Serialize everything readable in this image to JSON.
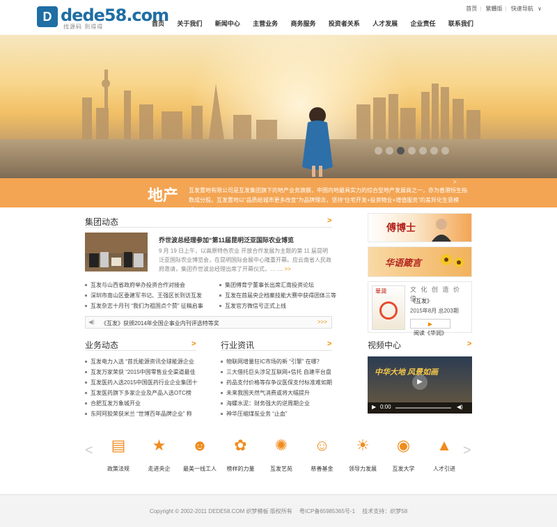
{
  "site": {
    "logo_text": "dede58.com",
    "logo_mark": "D",
    "logo_sub": "找源码  到得得"
  },
  "top_links": [
    "首页",
    "繁體版",
    "快速导航"
  ],
  "nav": [
    "首页",
    "关于我们",
    "新闻中心",
    "主营业务",
    "商务服务",
    "投资者关系",
    "人才发展",
    "企业责任",
    "联系我们"
  ],
  "banner": {
    "caption_title": "地产",
    "caption_text": "互发置地有限公司是互发集团旗下的地产业务旗舰，中国内地最具实力的综合型地产发展商之一，亦为香港恒生指数成分股。互发置地以“品质给城市更多改变”为品牌理念，坚持“住宅开发+投资物业+增值服务”的差异化生意模式。",
    "dot_count": 7,
    "active_dot": 2
  },
  "group_news": {
    "title": "集团动态",
    "more": ">",
    "feature_title": "乔世波总经理参加“第11届昆明泛亚国际农业博览",
    "feature_text": "9 月 19 日上午，以高原特色农业 开放合作发展为主题的第 11 届昆明泛亚国际农业博览会，在昆明国际会展中心隆重开幕。应云南省人民政府邀请，集团乔世波总经理出席了开幕仪式，… …",
    "feature_more": ">>",
    "list_left": [
      "互发与山西省政府举办投资合作对接会",
      "深圳市南山区委建军书记、王强区长到访互发",
      "互发杂志十月刊 “我们为祖国点个赞” 征稿启事"
    ],
    "list_right": [
      "集团傅育宁董事长出席汇南投资论坛",
      "互发在首届央企档案技能大赛中获得团体三等",
      "互发官方微信号正式上线"
    ]
  },
  "notice": {
    "icon": "◀)",
    "text": "《互发》获颁2014年全国企事业内刊评选特等奖",
    "more": ">>>"
  },
  "business_news": {
    "title": "业务动态",
    "more": ">",
    "items": [
      "互发电力入选 “首氏能源资讯全球能源企业",
      "互发万家荣获 “2015中国零售业全渠道最佳",
      "互发医药入选2015中国医药行业企业集团十",
      "互发医药旗下多家企业及产品入选OTC榜",
      "合肥互发万象城开业",
      "东阿阿胶荣获米兰 “世博百年品牌企业” 称"
    ]
  },
  "industry_news": {
    "title": "行业资讯",
    "more": ">",
    "items": [
      "物联网增量狂IC市场的新 “引擎” 在哪？",
      "三大借托巨头涉足互联网+信托 自建平台盘",
      "药品支付价格等存争议医保支付标准难如期",
      "未来我国天然气消费或将大幅提升",
      "海螺水泥：财务强大的逆周期企业",
      "神华压缩煤炭业务 “止血”"
    ]
  },
  "side": {
    "banner1_text": "傅博士",
    "banner2_text": "华语箴言",
    "magazine": {
      "slogan": "文 化 创 造 价 值",
      "name": "《互发》",
      "issue": "2015年8月 总203期",
      "button": "阅读《华润》",
      "cover_title": "華潤"
    },
    "video_title": "视频中心",
    "video_more": ">",
    "video_overlay": "中华大地  风景如画",
    "video_time": "0:00"
  },
  "icon_strip": [
    {
      "icon": "file-icon",
      "glyph": "▤",
      "label": "政策法规"
    },
    {
      "icon": "star-icon",
      "glyph": "★",
      "label": "走进央企"
    },
    {
      "icon": "worker-icon",
      "glyph": "☻",
      "label": "最美一线工人"
    },
    {
      "icon": "medal-icon",
      "glyph": "✿",
      "label": "榜样的力量"
    },
    {
      "icon": "art-icon",
      "glyph": "✺",
      "label": "互发艺苑"
    },
    {
      "icon": "charity-icon",
      "glyph": "☺",
      "label": "慈善基金"
    },
    {
      "icon": "sun-icon",
      "glyph": "☀",
      "label": "领导力发展"
    },
    {
      "icon": "university-icon",
      "glyph": "◉",
      "label": "互发大学"
    },
    {
      "icon": "graduation-icon",
      "glyph": "▲",
      "label": "人才引进"
    }
  ],
  "footer": {
    "copyright": "Copyright © 2002-2011 DEDE58.COM 织梦模板 版权所有",
    "icp": "粤ICP备65985365号-1",
    "support": "技术支持：织梦58"
  },
  "colors": {
    "accent": "#f08c00",
    "caption_bg": "#f3a553",
    "brand": "#1f6ea4"
  }
}
